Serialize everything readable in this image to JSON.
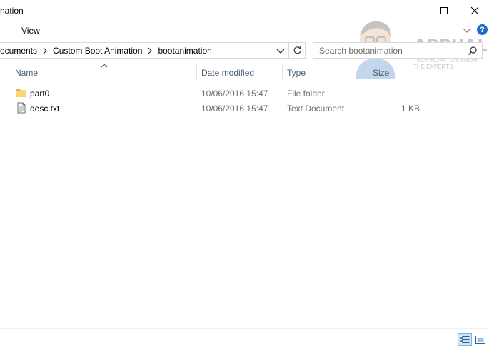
{
  "window": {
    "title": "nation"
  },
  "ribbon": {
    "tabs": [
      {
        "label": "View"
      }
    ],
    "help_label": "?"
  },
  "address": {
    "crumbs": [
      {
        "label": "ocuments"
      },
      {
        "label": "Custom Boot Animation"
      },
      {
        "label": "bootanimation"
      }
    ]
  },
  "search": {
    "placeholder": "Search bootanimation"
  },
  "columns": {
    "name": "Name",
    "date": "Date modified",
    "type": "Type",
    "size": "Size"
  },
  "files": [
    {
      "name": "part0",
      "date": "10/06/2016 15:47",
      "type": "File folder",
      "size": "",
      "icon": "folder-icon"
    },
    {
      "name": "desc.txt",
      "date": "10/06/2016 15:47",
      "type": "Text Document",
      "size": "1 KB",
      "icon": "text-file-icon"
    }
  ],
  "watermark": {
    "brand": "APPUALS",
    "tagline": "TECH HOW-TO'S FROM THE EXPERTS"
  },
  "colors": {
    "accent": "#1a6ccc",
    "header_text": "#4c607a",
    "secondary_text": "#6d6d6d",
    "folder": "#f8d775"
  }
}
